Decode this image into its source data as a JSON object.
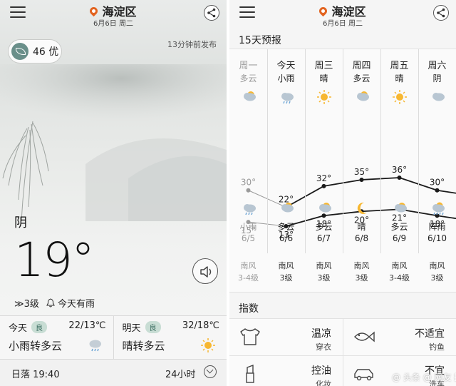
{
  "left": {
    "location": "海淀区",
    "date": "6月6日 周二",
    "aqi_value": "46 优",
    "published": "13分钟前发布",
    "condition": "阴",
    "temperature": "19°",
    "wind": "≫3级",
    "rain_note": "今天有雨",
    "today": {
      "label": "今天",
      "badge": "良",
      "range": "22/13℃",
      "desc": "小雨转多云",
      "icon": "cloud-rain-icon"
    },
    "tomorrow": {
      "label": "明天",
      "badge": "良",
      "range": "32/18℃",
      "desc": "晴转多云",
      "icon": "sun-icon"
    },
    "sunset": "日落 19:40",
    "hourly": "24小时"
  },
  "right": {
    "location": "海淀区",
    "date": "6月6日 周二",
    "forecast_title": "15天预报",
    "index_title": "指数",
    "days": [
      {
        "day": "周一",
        "day_cond": "多云",
        "day_icon": "partly-cloudy-icon",
        "night_icon": "cloud-rain-icon",
        "night_cond": "小雨",
        "date": "6/5",
        "wind": "南风",
        "level": "3-4级",
        "past": true
      },
      {
        "day": "今天",
        "day_cond": "小雨",
        "day_icon": "cloud-rain-icon",
        "night_icon": "partly-cloudy-icon",
        "night_cond": "多云",
        "date": "6/6",
        "wind": "南风",
        "level": "3级",
        "past": false
      },
      {
        "day": "周三",
        "day_cond": "晴",
        "day_icon": "sun-icon",
        "night_icon": "partly-cloudy-icon",
        "night_cond": "多云",
        "date": "6/7",
        "wind": "南风",
        "level": "3级",
        "past": false
      },
      {
        "day": "周四",
        "day_cond": "多云",
        "day_icon": "partly-cloudy-icon",
        "night_icon": "moon-icon",
        "night_cond": "晴",
        "date": "6/8",
        "wind": "南风",
        "level": "3级",
        "past": false
      },
      {
        "day": "周五",
        "day_cond": "晴",
        "day_icon": "sun-icon",
        "night_icon": "partly-cloudy-icon",
        "night_cond": "多云",
        "date": "6/9",
        "wind": "南风",
        "level": "3-4级",
        "past": false
      },
      {
        "day": "周六",
        "day_cond": "阴",
        "day_icon": "cloud-icon",
        "night_icon": "shower-icon",
        "night_cond": "阵雨",
        "date": "6/10",
        "wind": "南风",
        "level": "3级",
        "past": false
      }
    ],
    "highs": [
      30,
      22,
      32,
      35,
      36,
      30
    ],
    "lows": [
      15,
      13,
      18,
      20,
      21,
      18
    ],
    "high_labels": [
      "30°",
      "22°",
      "32°",
      "35°",
      "36°",
      "30°"
    ],
    "low_labels": [
      "15°",
      "13°",
      "18°",
      "20°",
      "21°",
      "18°"
    ],
    "indices": [
      {
        "value": "温凉",
        "key": "穿衣",
        "icon": "shirt-icon"
      },
      {
        "value": "不适宜",
        "key": "钓鱼",
        "icon": "fish-icon"
      },
      {
        "value": "控油",
        "key": "化妆",
        "icon": "lipstick-icon"
      },
      {
        "value": "不宜",
        "key": "洗车",
        "icon": "car-icon"
      }
    ]
  },
  "watermark": "@ 头条 @ 网友  提问与下资源",
  "colors": {
    "accent": "#e2631f",
    "badge_bg": "#c8ddd4",
    "badge_fg": "#36695c",
    "line": "#1a1a1a",
    "past_line": "#9a9a9a"
  }
}
